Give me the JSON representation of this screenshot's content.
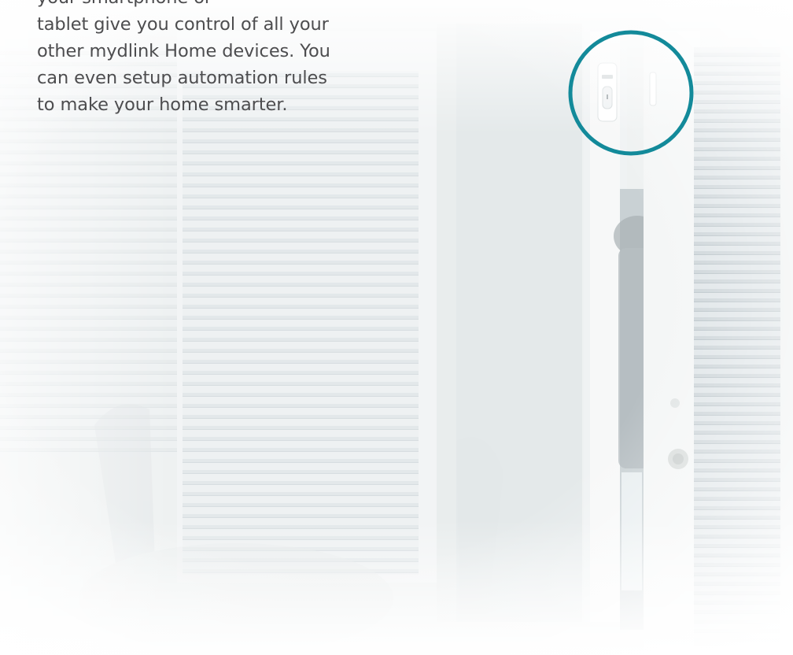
{
  "description_text": {
    "lines": [
      "your smartphone or",
      "tablet give you control of all your",
      "other mydlink Home devices. You",
      "can even setup automation rules",
      "to make your home smarter."
    ]
  },
  "highlight": {
    "ring_color": "#138a9a",
    "subject": "door-window-sensor"
  },
  "colors": {
    "text": "#4d4d4f",
    "background": "#f3f5f5"
  }
}
